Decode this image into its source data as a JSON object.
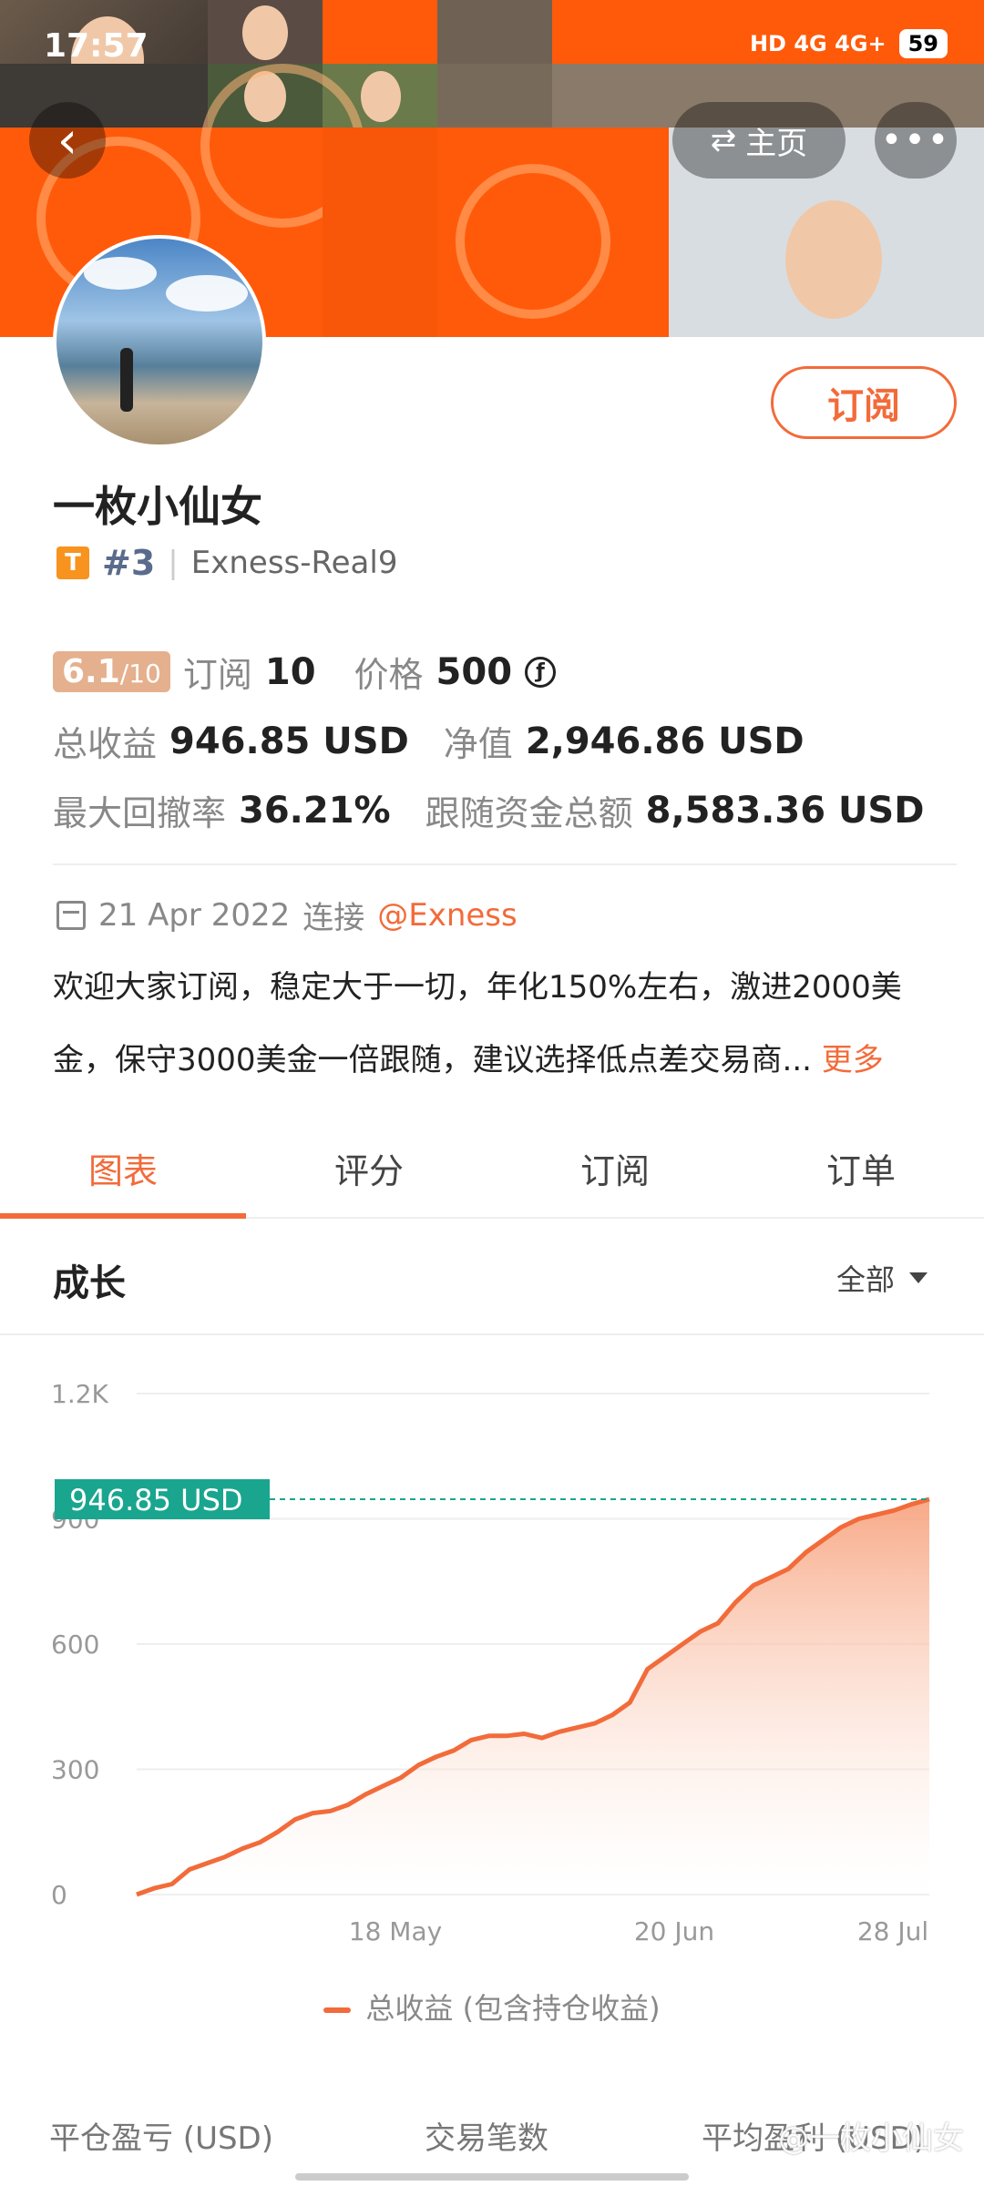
{
  "status_bar": {
    "time": "17:57",
    "network": "HD 4G 4G+",
    "battery": "59"
  },
  "nav": {
    "back_icon": "chevron-left-icon",
    "home_label": "主页",
    "more_icon": "more-dots-icon"
  },
  "profile": {
    "name": "一枚小仙女",
    "badge": "T",
    "rank": "#3",
    "account": "Exness-Real9",
    "subscribe_label": "订阅"
  },
  "stats": {
    "score_main": "6.1",
    "score_denom": "/10",
    "subs_label": "订阅",
    "subs_value": "10",
    "price_label": "价格",
    "price_value": "500",
    "price_icon": "ƒ",
    "total_label": "总收益",
    "total_value": "946.85 USD",
    "equity_label": "净值",
    "equity_value": "2,946.86 USD",
    "drawdown_label": "最大回撤率",
    "drawdown_value": "36.21%",
    "follow_label": "跟随资金总额",
    "follow_value": "8,583.36 USD"
  },
  "info": {
    "date": "21 Apr 2022",
    "connect_label": "连接",
    "broker_link": "@Exness",
    "description": "欢迎大家订阅，稳定大于一切，年化150%左右，激进2000美金，保守3000美金一倍跟随，建议选择低点差交易商...",
    "more_label": "更多"
  },
  "tabs": [
    {
      "label": "图表",
      "active": true
    },
    {
      "label": "评分",
      "active": false
    },
    {
      "label": "订阅",
      "active": false
    },
    {
      "label": "订单",
      "active": false
    }
  ],
  "section": {
    "title": "成长",
    "filter_label": "全部"
  },
  "chart_data": {
    "type": "area",
    "x_ticks": [
      "18 May",
      "20 Jun",
      "28 Jul"
    ],
    "y_ticks": [
      0,
      300,
      600,
      900,
      1200
    ],
    "y_tick_labels": [
      "0",
      "300",
      "600",
      "900",
      "1.2K"
    ],
    "ylim": [
      0,
      1200
    ],
    "current_value_label": "946.85 USD",
    "series": [
      {
        "name": "总收益 (包含持仓收益)",
        "values": [
          0,
          15,
          25,
          60,
          75,
          90,
          110,
          125,
          150,
          180,
          195,
          200,
          215,
          240,
          260,
          280,
          310,
          330,
          345,
          370,
          380,
          380,
          385,
          375,
          390,
          400,
          410,
          430,
          460,
          540,
          570,
          600,
          630,
          650,
          700,
          740,
          760,
          780,
          820,
          850,
          880,
          900,
          910,
          920,
          935,
          946.85
        ]
      }
    ],
    "color": "#f26b3a",
    "label_color": "#1aa58f"
  },
  "legend": {
    "label": "总收益 (包含持仓收益)"
  },
  "bottom_stats": {
    "closed_pl": "平仓盈亏 (USD)",
    "trades": "交易笔数",
    "avg_profit": "平均盈利 (USD)"
  },
  "watermark": "@一枚小仙女"
}
